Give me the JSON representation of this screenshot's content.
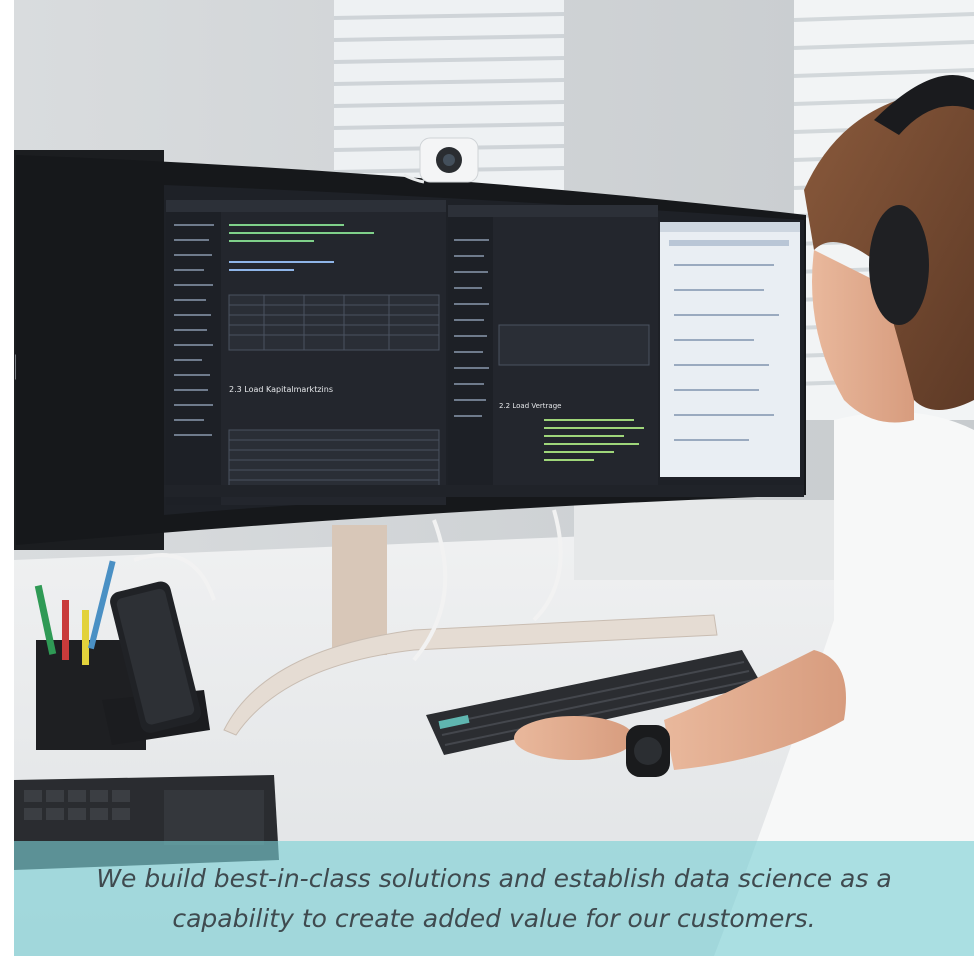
{
  "caption": {
    "line1": "We build best-in-class solutions and establish data science as a",
    "line2": "capability to create added value for our customers."
  },
  "monitor": {
    "left_pane": {
      "heading": "2.3 Load Kapitalmarktzins"
    },
    "right_pane": {
      "heading": "2.2 Load Vertrage"
    }
  },
  "colors": {
    "caption_band": "#7ad1d5",
    "caption_text": "#3f4a4f",
    "desk": "#e8eaeb",
    "monitor_frame": "#1a1c1f"
  }
}
